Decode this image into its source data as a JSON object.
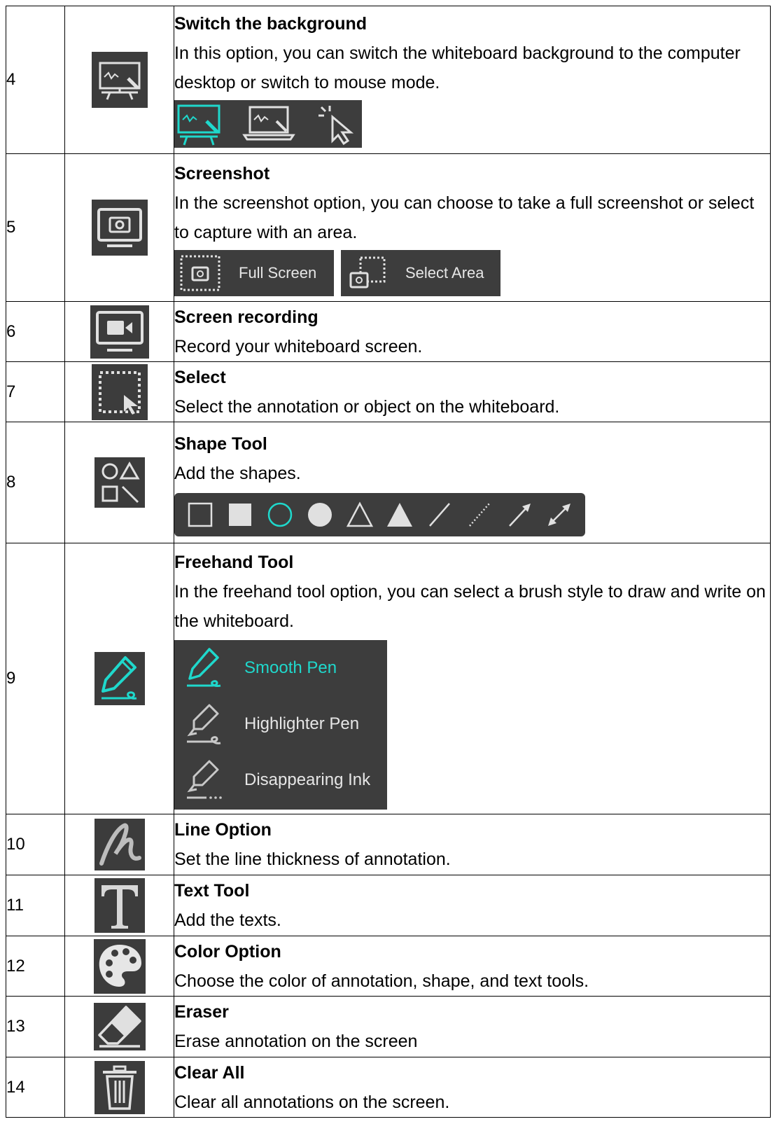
{
  "rows": [
    {
      "number": "4",
      "title": "Switch the background",
      "text": "In this option, you can switch the whiteboard background to the computer desktop or switch to mouse mode.",
      "icon": "whiteboard-easel-icon"
    },
    {
      "number": "5",
      "title": "Screenshot",
      "text": "In the screenshot option, you can choose to take a full screenshot or select to capture with an area.",
      "icon": "camera-monitor-icon"
    },
    {
      "number": "6",
      "title": "Screen recording",
      "text": "Record your whiteboard screen.",
      "icon": "video-monitor-icon"
    },
    {
      "number": "7",
      "title": "Select",
      "text": "Select the annotation or object on the whiteboard.",
      "icon": "select-area-icon"
    },
    {
      "number": "8",
      "title": "Shape Tool",
      "text": "Add the shapes.",
      "icon": "shapes-icon"
    },
    {
      "number": "9",
      "title": "Freehand Tool",
      "text": "In the freehand tool option, you can select a brush style to draw and write on the whiteboard.",
      "icon": "pen-icon"
    },
    {
      "number": "10",
      "title": "Line Option",
      "text": "Set the line thickness of annotation.",
      "icon": "line-thickness-icon"
    },
    {
      "number": "11",
      "title": "Text Tool",
      "text": "Add the texts.",
      "icon": "text-t-icon"
    },
    {
      "number": "12",
      "title": "Color Option",
      "text": "Choose the color of annotation, shape, and text tools.",
      "icon": "palette-icon"
    },
    {
      "number": "13",
      "title": "Eraser",
      "text": "Erase annotation on the screen",
      "icon": "eraser-icon"
    },
    {
      "number": "14",
      "title": "Clear All",
      "text": "Clear all annotations on the screen.",
      "icon": "trash-icon"
    }
  ],
  "screenshot_options": {
    "full": "Full Screen",
    "area": "Select Area"
  },
  "pen_styles": [
    {
      "label": "Smooth Pen",
      "active": true
    },
    {
      "label": "Highlighter Pen",
      "active": false
    },
    {
      "label": "Disappearing Ink",
      "active": false
    }
  ],
  "colors": {
    "accent": "#1fd8cc",
    "panel": "#3d3d3d",
    "icon_bg": "#3c3c3c",
    "icon_fg": "#e0e0e0"
  }
}
